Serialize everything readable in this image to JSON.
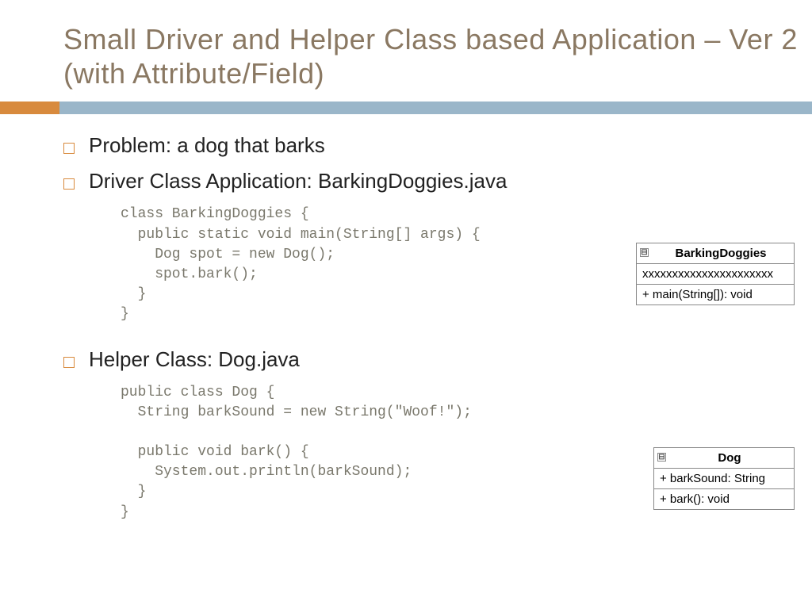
{
  "title": "Small Driver and Helper Class based Application – Ver 2 (with Attribute/Field)",
  "bullets": {
    "problem": "Problem: a dog that barks",
    "driver": "Driver Class Application: BarkingDoggies.java",
    "helper": "Helper Class: Dog.java"
  },
  "code": {
    "driver": "class BarkingDoggies {\n  public static void main(String[] args) {\n    Dog spot = new Dog();\n    spot.bark();\n  }\n}",
    "helper": "public class Dog {\n  String barkSound = new String(\"Woof!\");\n\n  public void bark() {\n    System.out.println(barkSound);\n  }\n}"
  },
  "uml": {
    "driver": {
      "name": "BarkingDoggies",
      "attrs": "xxxxxxxxxxxxxxxxxxxxxx",
      "methods": "+ main(String[]): void"
    },
    "helper": {
      "name": "Dog",
      "attrs": "+ barkSound: String",
      "methods": "+ bark(): void"
    },
    "collapse": "⊟"
  }
}
